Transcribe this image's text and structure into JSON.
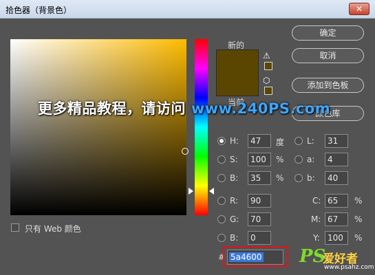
{
  "window": {
    "title": "拾色器（背景色）",
    "close_glyph": "✕"
  },
  "preview": {
    "new_label": "新的",
    "current_label": "当前",
    "color": "#5a4600",
    "warn_glyph": "⚠",
    "cube_glyph": "⬡"
  },
  "buttons": {
    "ok": "确定",
    "cancel": "取消",
    "add_to_swatches": "添加到色板",
    "color_libraries": "颜色库"
  },
  "hsb": [
    {
      "label": "H:",
      "value": "47",
      "unit": "度",
      "selected": true
    },
    {
      "label": "S:",
      "value": "100",
      "unit": "%",
      "selected": false
    },
    {
      "label": "B:",
      "value": "35",
      "unit": "%",
      "selected": false
    }
  ],
  "lab": [
    {
      "label": "L:",
      "value": "31"
    },
    {
      "label": "a:",
      "value": "4"
    },
    {
      "label": "b:",
      "value": "40"
    }
  ],
  "rgb": [
    {
      "label": "R:",
      "value": "90"
    },
    {
      "label": "G:",
      "value": "70"
    },
    {
      "label": "B:",
      "value": "0"
    }
  ],
  "cmyk": [
    {
      "label": "C:",
      "value": "65",
      "unit": "%"
    },
    {
      "label": "M:",
      "value": "67",
      "unit": "%"
    },
    {
      "label": "Y:",
      "value": "100",
      "unit": "%"
    }
  ],
  "hex": {
    "prefix": "#",
    "value": "5a4600"
  },
  "web_only": {
    "label": "只有 Web 颜色",
    "checked": false
  },
  "watermark": {
    "text": "更多精品教程，请访问 ",
    "url": "www.240PS.com"
  },
  "logo": {
    "ps": "PS",
    "cn": "爱好者",
    "url": "www.psahz.com"
  },
  "colors": {
    "accent": "#3b78d8",
    "highlight": "#e0141e",
    "chrome": "#535353"
  }
}
